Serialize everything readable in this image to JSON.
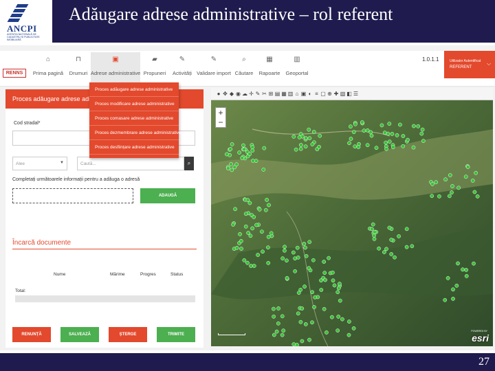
{
  "slide": {
    "title": "Adăugare adrese administrative – rol referent",
    "page_number": "27",
    "logo": {
      "name": "ANCPI",
      "subtitle": "AGENȚIA NAȚIONALĂ DE CADASTRU ȘI PUBLICITATE IMOBILIARĂ"
    }
  },
  "app": {
    "brand": "RENNS",
    "version": "1.0.1.1",
    "user": {
      "line1": "Utilizator Autentificat",
      "line2": "REFERENT"
    },
    "nav": [
      {
        "label": "Prima pagină",
        "icon": "home-icon",
        "glyph": "⌂"
      },
      {
        "label": "Drumuri",
        "icon": "road-icon",
        "glyph": "⊓"
      },
      {
        "label": "Adrese administrative",
        "icon": "address-icon",
        "glyph": "▣"
      },
      {
        "label": "Propuneri",
        "icon": "folder-icon",
        "glyph": "▰"
      },
      {
        "label": "Activități",
        "icon": "edit-icon",
        "glyph": "✎"
      },
      {
        "label": "Validare import",
        "icon": "validate-icon",
        "glyph": "✎"
      },
      {
        "label": "Căutare",
        "icon": "search-icon",
        "glyph": "⌕"
      },
      {
        "label": "Rapoarte",
        "icon": "report-icon",
        "glyph": "▦"
      },
      {
        "label": "Geoportal",
        "icon": "geoportal-icon",
        "glyph": "▥"
      }
    ],
    "dropdown": [
      "Proces adăugare adrese administrative",
      "Proces modificare adrese administrative",
      "Proces comasare adrese administrative",
      "Proces dezmembrare adrese administrative",
      "Proces desființare adrese administrative"
    ],
    "form": {
      "panel_title": "Proces adăugare adrese administrative",
      "street_label": "Cod stradal*",
      "type_value": "Alee",
      "search_placeholder": "Caută...",
      "info_text": "Completați următoarele informații pentru a adăuga o adresă",
      "add_button": "ADAUGĂ",
      "upload_title": "Încarcă documente",
      "columns": [
        "Nume",
        "Mărime",
        "Progres",
        "Status"
      ],
      "total_label": "Total:",
      "buttons": [
        "RENUNȚĂ",
        "SALVEAZĂ",
        "ȘTERGE",
        "TRIMITE"
      ]
    },
    "map": {
      "esri_label": "esri",
      "esri_prefix": "POWERED BY",
      "colors": {
        "marker": "#38c436",
        "terrain": "#4a6a3a"
      }
    }
  }
}
